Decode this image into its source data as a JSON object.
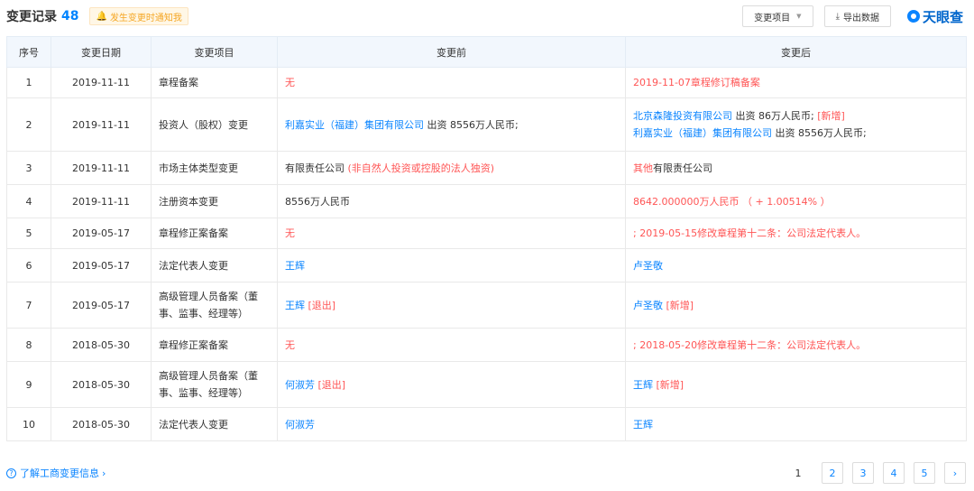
{
  "header": {
    "title": "变更记录",
    "count": "48",
    "notify_label": "发生变更时通知我",
    "filter_button": "变更项目",
    "export_button": "导出数据",
    "logo_text": "天眼查"
  },
  "columns": [
    "序号",
    "变更日期",
    "变更项目",
    "变更前",
    "变更后"
  ],
  "rows": [
    {
      "no": "1",
      "date": "2019-11-11",
      "item": "章程备案",
      "before": [
        [
          {
            "t": "无",
            "c": "red"
          }
        ]
      ],
      "after": [
        [
          {
            "t": "2019-11-07章程修订稿备案",
            "c": "red"
          }
        ]
      ]
    },
    {
      "no": "2",
      "date": "2019-11-11",
      "item": "投资人（股权）变更",
      "before": [
        [
          {
            "t": "利嘉实业（福建）集团有限公司",
            "c": "blue"
          },
          {
            "t": " 出资 8556万人民币;",
            "c": "dark"
          }
        ]
      ],
      "after": [
        [
          {
            "t": "北京森隆投资有限公司",
            "c": "blue"
          },
          {
            "t": " 出资 86万人民币; ",
            "c": "dark"
          },
          {
            "t": "[新增]",
            "c": "red"
          }
        ],
        [
          {
            "t": "利嘉实业（福建）集团有限公司",
            "c": "blue"
          },
          {
            "t": " 出资 8556万人民币;",
            "c": "dark"
          }
        ]
      ]
    },
    {
      "no": "3",
      "date": "2019-11-11",
      "item": "市场主体类型变更",
      "before": [
        [
          {
            "t": "有限责任公司 ",
            "c": "dark"
          },
          {
            "t": "(非自然人投资或控股的法人独资)",
            "c": "red"
          }
        ]
      ],
      "after": [
        [
          {
            "t": "其他",
            "c": "red"
          },
          {
            "t": "有限责任公司",
            "c": "dark"
          }
        ]
      ]
    },
    {
      "no": "4",
      "date": "2019-11-11",
      "item": "注册资本变更",
      "before": [
        [
          {
            "t": "8556万人民币",
            "c": "dark"
          }
        ]
      ],
      "after": [
        [
          {
            "t": "8642.000000万人民币 （ + 1.00514% ）",
            "c": "red"
          }
        ]
      ]
    },
    {
      "no": "5",
      "date": "2019-05-17",
      "item": "章程修正案备案",
      "before": [
        [
          {
            "t": "无",
            "c": "red"
          }
        ]
      ],
      "after": [
        [
          {
            "t": "; 2019-05-15修改章程第十二条：公司法定代表人。",
            "c": "red"
          }
        ]
      ]
    },
    {
      "no": "6",
      "date": "2019-05-17",
      "item": "法定代表人变更",
      "before": [
        [
          {
            "t": "王辉",
            "c": "blue"
          }
        ]
      ],
      "after": [
        [
          {
            "t": "卢圣敬",
            "c": "blue"
          }
        ]
      ]
    },
    {
      "no": "7",
      "date": "2019-05-17",
      "item": "高级管理人员备案（董事、监事、经理等）",
      "before": [
        [
          {
            "t": "王辉",
            "c": "blue"
          },
          {
            "t": " [退出]",
            "c": "red"
          }
        ]
      ],
      "after": [
        [
          {
            "t": "卢圣敬",
            "c": "blue"
          },
          {
            "t": " [新增]",
            "c": "red"
          }
        ]
      ]
    },
    {
      "no": "8",
      "date": "2018-05-30",
      "item": "章程修正案备案",
      "before": [
        [
          {
            "t": "无",
            "c": "red"
          }
        ]
      ],
      "after": [
        [
          {
            "t": "; 2018-05-20修改章程第十二条：公司法定代表人。",
            "c": "red"
          }
        ]
      ]
    },
    {
      "no": "9",
      "date": "2018-05-30",
      "item": "高级管理人员备案（董事、监事、经理等）",
      "before": [
        [
          {
            "t": "何淑芳",
            "c": "blue"
          },
          {
            "t": " [退出]",
            "c": "red"
          }
        ]
      ],
      "after": [
        [
          {
            "t": "王辉",
            "c": "blue"
          },
          {
            "t": " [新增]",
            "c": "red"
          }
        ]
      ]
    },
    {
      "no": "10",
      "date": "2018-05-30",
      "item": "法定代表人变更",
      "before": [
        [
          {
            "t": "何淑芳",
            "c": "blue"
          }
        ]
      ],
      "after": [
        [
          {
            "t": "王辉",
            "c": "blue"
          }
        ]
      ]
    }
  ],
  "footer": {
    "help_link": "了解工商变更信息",
    "pagination": {
      "current": "1",
      "pages": [
        "2",
        "3",
        "4",
        "5"
      ],
      "next": "›"
    }
  },
  "colors": {
    "accent": "#0a84ff",
    "highlight_red": "#ff5555",
    "header_bg": "#f2f7fd",
    "notify_bg": "#fff7e6"
  }
}
